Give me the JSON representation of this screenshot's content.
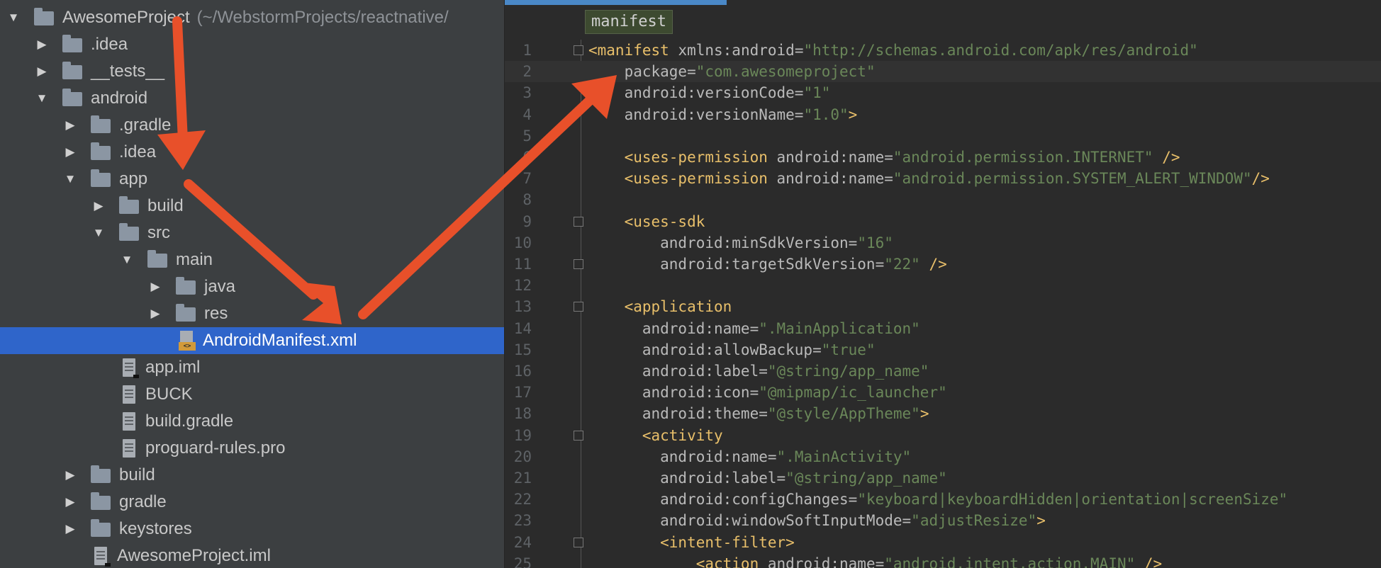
{
  "project_tree": {
    "root": {
      "name": "AwesomeProject",
      "path_hint": "(~/WebstormProjects/reactnative/"
    },
    "items": [
      {
        "label": ".idea",
        "kind": "folder",
        "depth": 1,
        "expander": "collapsed"
      },
      {
        "label": "__tests__",
        "kind": "folder",
        "depth": 1,
        "expander": "collapsed"
      },
      {
        "label": "android",
        "kind": "folder",
        "depth": 1,
        "expander": "expanded"
      },
      {
        "label": ".gradle",
        "kind": "folder",
        "depth": 2,
        "expander": "collapsed"
      },
      {
        "label": ".idea",
        "kind": "folder",
        "depth": 2,
        "expander": "collapsed"
      },
      {
        "label": "app",
        "kind": "folder",
        "depth": 2,
        "expander": "expanded"
      },
      {
        "label": "build",
        "kind": "folder",
        "depth": 3,
        "expander": "collapsed"
      },
      {
        "label": "src",
        "kind": "folder",
        "depth": 3,
        "expander": "expanded"
      },
      {
        "label": "main",
        "kind": "folder",
        "depth": 4,
        "expander": "expanded"
      },
      {
        "label": "java",
        "kind": "folder",
        "depth": 5,
        "expander": "collapsed"
      },
      {
        "label": "res",
        "kind": "folder",
        "depth": 5,
        "expander": "collapsed"
      },
      {
        "label": "AndroidManifest.xml",
        "kind": "xml",
        "depth": 5,
        "expander": "none",
        "selected": true
      },
      {
        "label": "app.iml",
        "kind": "iml",
        "depth": 3,
        "expander": "none"
      },
      {
        "label": "BUCK",
        "kind": "file",
        "depth": 3,
        "expander": "none"
      },
      {
        "label": "build.gradle",
        "kind": "file",
        "depth": 3,
        "expander": "none"
      },
      {
        "label": "proguard-rules.pro",
        "kind": "file",
        "depth": 3,
        "expander": "none"
      },
      {
        "label": "build",
        "kind": "folder",
        "depth": 2,
        "expander": "collapsed"
      },
      {
        "label": "gradle",
        "kind": "folder",
        "depth": 2,
        "expander": "collapsed"
      },
      {
        "label": "keystores",
        "kind": "folder",
        "depth": 2,
        "expander": "collapsed"
      },
      {
        "label": "AwesomeProject.iml",
        "kind": "iml",
        "depth": 2,
        "expander": "none"
      }
    ]
  },
  "editor": {
    "breadcrumb": "manifest",
    "lines": [
      {
        "n": "1",
        "fold": true,
        "code": [
          [
            "tg",
            "<manifest "
          ],
          [
            "at",
            "xmlns:android"
          ],
          [
            "eq",
            "="
          ],
          [
            "st",
            "\"http://schemas.android.com/apk/res/android\""
          ]
        ]
      },
      {
        "n": "2",
        "current": true,
        "code": [
          [
            "at",
            "    package"
          ],
          [
            "eq",
            "="
          ],
          [
            "st",
            "\"com.awesomeproject\""
          ]
        ]
      },
      {
        "n": "3",
        "code": [
          [
            "at",
            "    android:versionCode"
          ],
          [
            "eq",
            "="
          ],
          [
            "st",
            "\"1\""
          ]
        ]
      },
      {
        "n": "4",
        "code": [
          [
            "at",
            "    android:versionName"
          ],
          [
            "eq",
            "="
          ],
          [
            "st",
            "\"1.0\""
          ],
          [
            "tg",
            ">"
          ]
        ]
      },
      {
        "n": "5",
        "code": []
      },
      {
        "n": "6",
        "code": [
          [
            "tg",
            "    <uses-permission "
          ],
          [
            "at",
            "android:name"
          ],
          [
            "eq",
            "="
          ],
          [
            "st",
            "\"android.permission.INTERNET\""
          ],
          [
            "tg",
            " />"
          ]
        ]
      },
      {
        "n": "7",
        "code": [
          [
            "tg",
            "    <uses-permission "
          ],
          [
            "at",
            "android:name"
          ],
          [
            "eq",
            "="
          ],
          [
            "st",
            "\"android.permission.SYSTEM_ALERT_WINDOW\""
          ],
          [
            "tg",
            "/>"
          ]
        ]
      },
      {
        "n": "8",
        "code": []
      },
      {
        "n": "9",
        "fold": true,
        "code": [
          [
            "tg",
            "    <uses-sdk"
          ]
        ]
      },
      {
        "n": "10",
        "code": [
          [
            "at",
            "        android:minSdkVersion"
          ],
          [
            "eq",
            "="
          ],
          [
            "st",
            "\"16\""
          ]
        ]
      },
      {
        "n": "11",
        "fold": true,
        "code": [
          [
            "at",
            "        android:targetSdkVersion"
          ],
          [
            "eq",
            "="
          ],
          [
            "st",
            "\"22\""
          ],
          [
            "tg",
            " />"
          ]
        ]
      },
      {
        "n": "12",
        "code": []
      },
      {
        "n": "13",
        "fold": true,
        "code": [
          [
            "tg",
            "    <application"
          ]
        ]
      },
      {
        "n": "14",
        "code": [
          [
            "at",
            "      android:name"
          ],
          [
            "eq",
            "="
          ],
          [
            "st",
            "\".MainApplication\""
          ]
        ]
      },
      {
        "n": "15",
        "code": [
          [
            "at",
            "      android:allowBackup"
          ],
          [
            "eq",
            "="
          ],
          [
            "st",
            "\"true\""
          ]
        ]
      },
      {
        "n": "16",
        "code": [
          [
            "at",
            "      android:label"
          ],
          [
            "eq",
            "="
          ],
          [
            "st",
            "\"@string/app_name\""
          ]
        ]
      },
      {
        "n": "17",
        "code": [
          [
            "at",
            "      android:icon"
          ],
          [
            "eq",
            "="
          ],
          [
            "st",
            "\"@mipmap/ic_launcher\""
          ]
        ]
      },
      {
        "n": "18",
        "code": [
          [
            "at",
            "      android:theme"
          ],
          [
            "eq",
            "="
          ],
          [
            "st",
            "\"@style/AppTheme\""
          ],
          [
            "tg",
            ">"
          ]
        ]
      },
      {
        "n": "19",
        "fold": true,
        "code": [
          [
            "tg",
            "      <activity"
          ]
        ]
      },
      {
        "n": "20",
        "code": [
          [
            "at",
            "        android:name"
          ],
          [
            "eq",
            "="
          ],
          [
            "st",
            "\".MainActivity\""
          ]
        ]
      },
      {
        "n": "21",
        "code": [
          [
            "at",
            "        android:label"
          ],
          [
            "eq",
            "="
          ],
          [
            "st",
            "\"@string/app_name\""
          ]
        ]
      },
      {
        "n": "22",
        "code": [
          [
            "at",
            "        android:configChanges"
          ],
          [
            "eq",
            "="
          ],
          [
            "st",
            "\"keyboard|keyboardHidden|orientation|screenSize\""
          ]
        ]
      },
      {
        "n": "23",
        "code": [
          [
            "at",
            "        android:windowSoftInputMode"
          ],
          [
            "eq",
            "="
          ],
          [
            "st",
            "\"adjustResize\""
          ],
          [
            "tg",
            ">"
          ]
        ]
      },
      {
        "n": "24",
        "fold": true,
        "code": [
          [
            "tg",
            "        <intent-filter>"
          ]
        ]
      },
      {
        "n": "25",
        "code": [
          [
            "tg",
            "            <action "
          ],
          [
            "at",
            "android:name"
          ],
          [
            "eq",
            "="
          ],
          [
            "st",
            "\"android.intent.action.MAIN\""
          ],
          [
            "tg",
            " />"
          ]
        ]
      }
    ]
  },
  "annotation_color": "#e8502a"
}
